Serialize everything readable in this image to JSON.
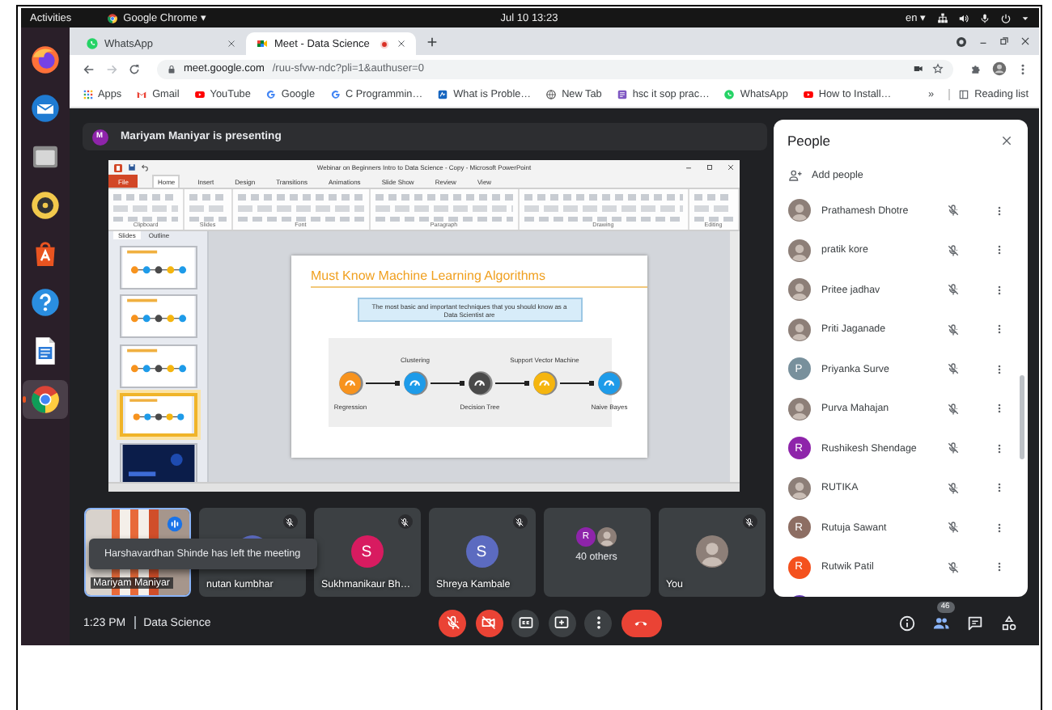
{
  "top_bar": {
    "activities": "Activities",
    "app_menu": "Google Chrome ▾",
    "clock": "Jul 10  13:23",
    "language": "en ▾"
  },
  "dock": [
    {
      "kind": "firefox",
      "selected": false
    },
    {
      "kind": "mail",
      "selected": false
    },
    {
      "kind": "files",
      "selected": false
    },
    {
      "kind": "music",
      "selected": false
    },
    {
      "kind": "software",
      "selected": false
    },
    {
      "kind": "help",
      "selected": false
    },
    {
      "kind": "writer",
      "selected": false
    },
    {
      "kind": "chrome",
      "selected": true
    }
  ],
  "browser": {
    "tabs": [
      {
        "title": "WhatsApp",
        "kind": "whatsapp",
        "selected": false,
        "recording": false
      },
      {
        "title": "Meet - Data Science",
        "kind": "meet",
        "selected": true,
        "recording": true
      }
    ],
    "url": {
      "host": "meet.google.com",
      "path": "/ruu-sfvw-ndc?pli=1&authuser=0"
    },
    "bookmarks": [
      {
        "label": "Apps",
        "kind": "apps"
      },
      {
        "label": "Gmail",
        "kind": "gmail"
      },
      {
        "label": "YouTube",
        "kind": "youtube"
      },
      {
        "label": "Google",
        "kind": "google"
      },
      {
        "label": "C Programmin…",
        "kind": "google"
      },
      {
        "label": "What is Proble…",
        "kind": "site"
      },
      {
        "label": "New Tab",
        "kind": "globe"
      },
      {
        "label": "hsc it sop prac…",
        "kind": "tile"
      },
      {
        "label": "WhatsApp",
        "kind": "whatsapp"
      },
      {
        "label": "How to Install…",
        "kind": "youtube"
      }
    ],
    "bookmarks_more": "»",
    "reading_list": "Reading list"
  },
  "meet": {
    "presenter": {
      "initial": "M",
      "color": "#8e24aa",
      "text": "Mariyam Maniyar is presenting"
    },
    "presentation": {
      "window_title": "Webinar on Beginners Intro to Data Science - Copy - Microsoft PowerPoint",
      "ribbon_tabs": [
        {
          "label": "File",
          "kind": "file",
          "selected": false
        },
        {
          "label": "Home",
          "kind": "tab",
          "selected": true
        },
        {
          "label": "Insert",
          "kind": "tab",
          "selected": false
        },
        {
          "label": "Design",
          "kind": "tab",
          "selected": false
        },
        {
          "label": "Transitions",
          "kind": "tab",
          "selected": false
        },
        {
          "label": "Animations",
          "kind": "tab",
          "selected": false
        },
        {
          "label": "Slide Show",
          "kind": "tab",
          "selected": false
        },
        {
          "label": "Review",
          "kind": "tab",
          "selected": false
        },
        {
          "label": "View",
          "kind": "tab",
          "selected": false
        }
      ],
      "ribbon_groups": [
        "Clipboard",
        "Slides",
        "Font",
        "Paragraph",
        "Drawing",
        "Editing"
      ],
      "pane_tabs": [
        {
          "label": "Slides",
          "selected": true
        },
        {
          "label": "Outline",
          "selected": false
        }
      ],
      "thumbnails": [
        {
          "kind": "diagram",
          "selected": false
        },
        {
          "kind": "diagram",
          "selected": false
        },
        {
          "kind": "diagram",
          "selected": false
        },
        {
          "kind": "diagram",
          "selected": true
        },
        {
          "kind": "dark",
          "selected": false
        }
      ],
      "slide": {
        "title": "Must Know Machine Learning Algorithms",
        "callout": "The most basic and important techniques that you should know as a Data Scientist are",
        "algorithms": [
          {
            "label": "Regression",
            "color": "#f7931e"
          },
          {
            "label": "Clustering",
            "color": "#1e9be9"
          },
          {
            "label": "Decision Tree",
            "color": "#4a4a4a"
          },
          {
            "label": "Support Vector Machine",
            "color": "#f5b50f"
          },
          {
            "label": "Naive Bayes",
            "color": "#1e9be9"
          }
        ]
      }
    },
    "tiles": [
      {
        "name": "Mariyam Maniyar",
        "kind": "video",
        "speaking": true,
        "muted": false
      },
      {
        "name": "nutan kumbhar",
        "kind": "avatar",
        "avatar": {
          "kind": "letter",
          "color": "#5c6bc0"
        },
        "speaking": false,
        "muted": true
      },
      {
        "name": "Sukhmanikaur Bh…",
        "kind": "avatar",
        "avatar": {
          "kind": "letter",
          "initial": "S",
          "color": "#d81b60"
        },
        "speaking": false,
        "muted": true
      },
      {
        "name": "Shreya Kambale",
        "kind": "avatar",
        "avatar": {
          "kind": "letter",
          "initial": "S",
          "color": "#5c6bc0"
        },
        "speaking": false,
        "muted": true
      },
      {
        "kind": "group",
        "count_label": "40 others",
        "avatars": [
          {
            "kind": "letter",
            "initial": "R",
            "color": "#8e24aa"
          },
          {
            "kind": "photo"
          }
        ],
        "speaking": false,
        "muted": false
      },
      {
        "name": "You",
        "kind": "avatar",
        "avatar": {
          "kind": "photo"
        },
        "speaking": false,
        "muted": true
      }
    ],
    "toast": "Harshavardhan Shinde has left the meeting",
    "meeting_time": "1:23 PM",
    "meeting_name": "Data Science",
    "controls": [
      {
        "kind": "mic",
        "on": false
      },
      {
        "kind": "camera",
        "on": false
      },
      {
        "kind": "captions",
        "on": false
      },
      {
        "kind": "present",
        "on": false
      },
      {
        "kind": "more"
      },
      {
        "kind": "hangup"
      }
    ],
    "side_buttons": [
      {
        "kind": "info",
        "selected": false
      },
      {
        "kind": "people",
        "selected": true,
        "badge": "46"
      },
      {
        "kind": "chat",
        "selected": false
      },
      {
        "kind": "activities",
        "selected": false
      }
    ],
    "panel": {
      "title": "People",
      "add_people": "Add people",
      "people": [
        {
          "name": "Prathamesh Dhotre",
          "avatar": {
            "kind": "photo"
          },
          "muted": true
        },
        {
          "name": "pratik kore",
          "avatar": {
            "kind": "photo"
          },
          "muted": true
        },
        {
          "name": "Pritee jadhav",
          "avatar": {
            "kind": "photo"
          },
          "muted": true
        },
        {
          "name": "Priti Jaganade",
          "avatar": {
            "kind": "photo"
          },
          "muted": true
        },
        {
          "name": "Priyanka Surve",
          "avatar": {
            "kind": "letter",
            "initial": "P",
            "color": "#78909c"
          },
          "muted": true
        },
        {
          "name": "Purva Mahajan",
          "avatar": {
            "kind": "photo"
          },
          "muted": true
        },
        {
          "name": "Rushikesh Shendage",
          "avatar": {
            "kind": "letter",
            "initial": "R",
            "color": "#8e24aa"
          },
          "muted": true
        },
        {
          "name": "RUTIKA",
          "avatar": {
            "kind": "photo"
          },
          "muted": true
        },
        {
          "name": "Rutuja Sawant",
          "avatar": {
            "kind": "letter",
            "initial": "R",
            "color": "#8d6e63"
          },
          "muted": true
        },
        {
          "name": "Rutwik Patil",
          "avatar": {
            "kind": "letter",
            "initial": "R",
            "color": "#f4511e"
          },
          "muted": true
        },
        {
          "avatar": {
            "kind": "letter",
            "color": "#5e35b1"
          }
        }
      ]
    }
  }
}
